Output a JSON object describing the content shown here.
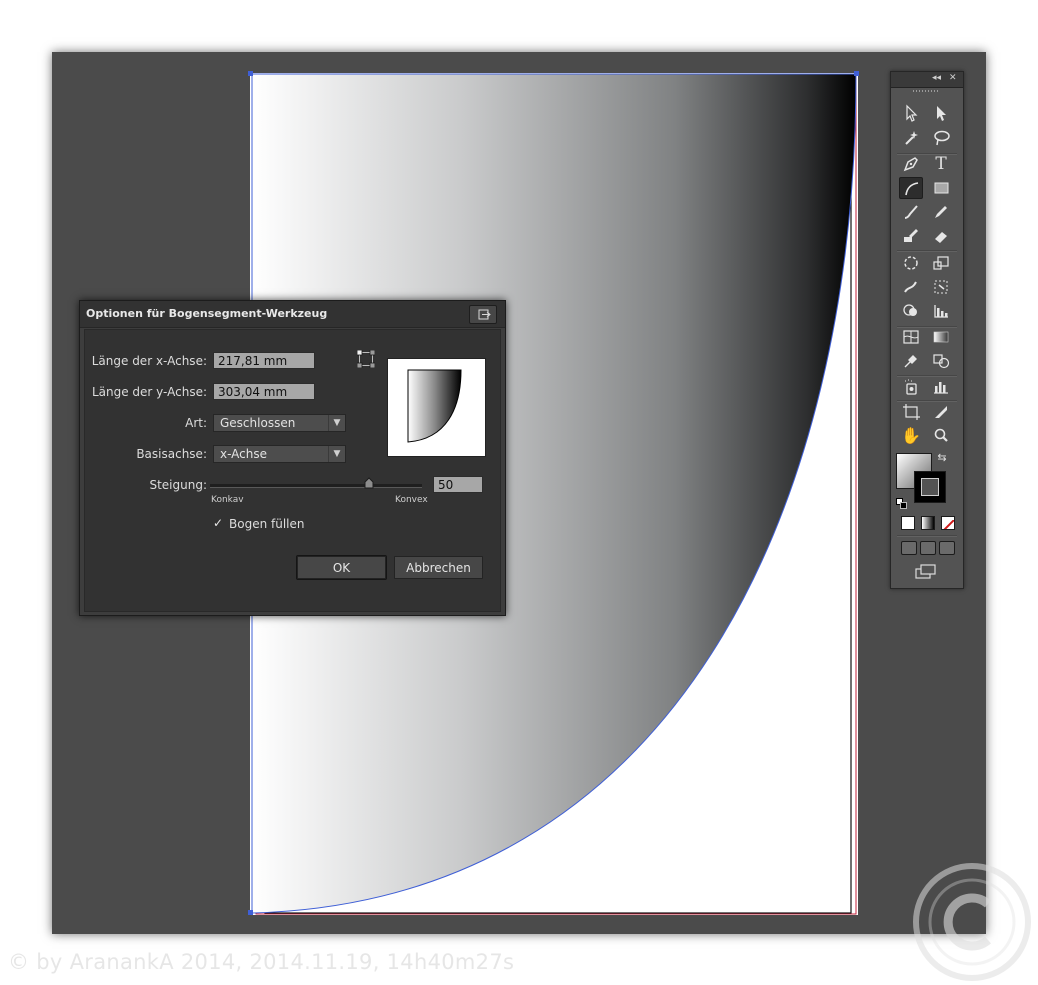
{
  "dialog": {
    "title": "Optionen für Bogensegment-Werkzeug",
    "x_length_label": "Länge der x-Achse:",
    "x_length_value": "217,81 mm",
    "y_length_label": "Länge der y-Achse:",
    "y_length_value": "303,04 mm",
    "type_label": "Art:",
    "type_value": "Geschlossen",
    "base_axis_label": "Basisachse:",
    "base_axis_value": "x-Achse",
    "slope_label": "Steigung:",
    "slope_value": "50",
    "slope_fraction": 0.75,
    "concave_label": "Konkav",
    "convex_label": "Konvex",
    "fill_arc_label": "Bogen füllen",
    "fill_arc_checked": true,
    "ok_label": "OK",
    "cancel_label": "Abbrechen"
  },
  "tools_panel": {
    "collapse_icon": "double-chevron-left-icon",
    "close_icon": "close-icon",
    "tools": [
      "selection-tool-icon",
      "direct-selection-tool-icon",
      "magic-wand-tool-icon",
      "lasso-tool-icon",
      "pen-tool-icon",
      "type-tool-icon",
      "arc-tool-icon",
      "rectangle-tool-icon",
      "paintbrush-tool-icon",
      "pencil-tool-icon",
      "blob-brush-tool-icon",
      "eraser-tool-icon",
      "rotate-tool-icon",
      "scale-tool-icon",
      "warp-tool-icon",
      "free-transform-tool-icon",
      "shape-builder-tool-icon",
      "graph-tool-icon",
      "mesh-tool-icon",
      "gradient-tool-icon",
      "eyedropper-tool-icon",
      "blend-tool-icon",
      "symbol-sprayer-tool-icon",
      "column-graph-tool-icon",
      "artboard-tool-icon",
      "slice-tool-icon",
      "hand-tool-icon",
      "zoom-tool-icon"
    ],
    "active_tool": "arc-tool-icon",
    "fill_colors": [
      "#ffffff",
      "#6a6a6a"
    ],
    "stroke_color": "#000000"
  },
  "watermark": "© by AranankA 2014, 2014.11.19, 14h40m27s"
}
